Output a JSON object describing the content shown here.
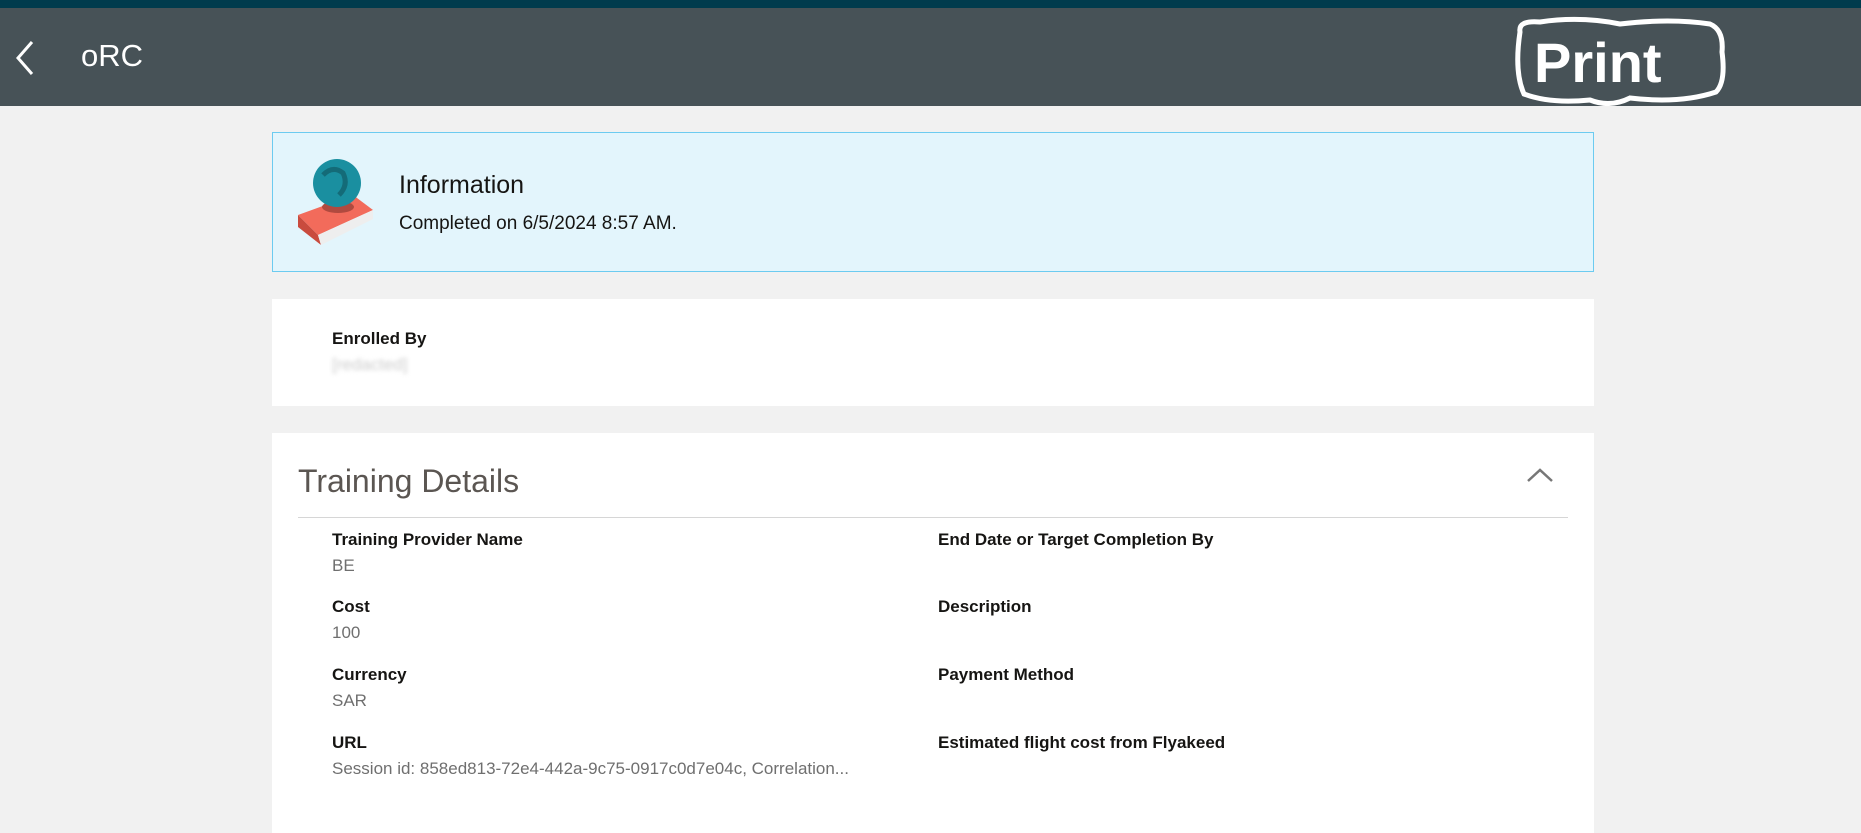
{
  "header": {
    "back_icon": "chevron-left-icon",
    "title": "oRC",
    "annotation": "Print"
  },
  "info": {
    "icon": "globe-on-book-icon",
    "title": "Information",
    "message": "Completed on 6/5/2024 8:57 AM."
  },
  "enrollment": {
    "label": "Enrolled By",
    "value": "[redacted]"
  },
  "training": {
    "title": "Training Details",
    "collapse_icon": "chevron-up-icon",
    "left": [
      {
        "label": "Training Provider Name",
        "value": "BE"
      },
      {
        "label": "Cost",
        "value": "100"
      },
      {
        "label": "Currency",
        "value": "SAR"
      },
      {
        "label": "URL",
        "value": "Session id: 858ed813-72e4-442a-9c75-0917c0d7e04c, Correlation..."
      }
    ],
    "right": [
      {
        "label": "End Date or Target Completion By",
        "value": ""
      },
      {
        "label": "Description",
        "value": ""
      },
      {
        "label": "Payment Method",
        "value": ""
      },
      {
        "label": "Estimated flight cost from Flyakeed",
        "value": ""
      }
    ]
  }
}
